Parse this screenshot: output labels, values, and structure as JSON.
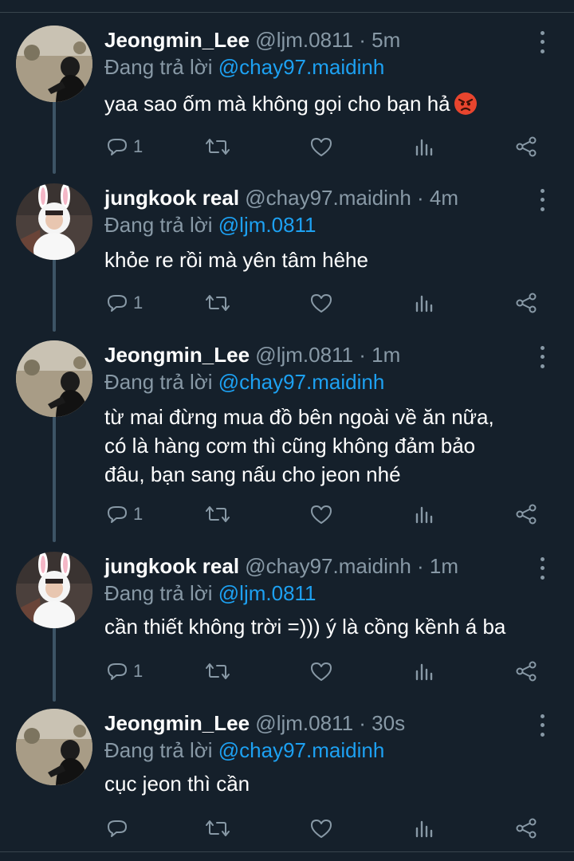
{
  "tweets": [
    {
      "name": "Jeongmin_Lee",
      "handle": "@ljm.0811",
      "time": "· 5m",
      "replying_prefix": "Đang trả lời ",
      "replying_to": "@chay97.maidinh",
      "text": "yaa sao ốm mà không gọi cho bạn hả",
      "emoji": "angry-face-emoji",
      "reply_count": "1",
      "avatar": "jeongmin-avatar"
    },
    {
      "name": "jungkook real",
      "handle": "@chay97.maidinh",
      "time": "· 4m",
      "replying_prefix": "Đang trả lời ",
      "replying_to": "@ljm.0811",
      "text": "khỏe re rồi mà yên tâm hêhe",
      "reply_count": "1",
      "avatar": "jungkook-bunny-avatar"
    },
    {
      "name": "Jeongmin_Lee",
      "handle": "@ljm.0811",
      "time": "· 1m",
      "replying_prefix": "Đang trả lời ",
      "replying_to": "@chay97.maidinh",
      "text_lines": [
        "từ mai đừng mua đồ bên ngoài về ăn nữa,",
        "có là hàng cơm thì cũng không đảm bảo",
        "đâu, bạn sang nấu cho jeon nhé"
      ],
      "reply_count": "1",
      "avatar": "jeongmin-avatar"
    },
    {
      "name": "jungkook real",
      "handle": "@chay97.maidinh",
      "time": "· 1m",
      "replying_prefix": "Đang trả lời ",
      "replying_to": "@ljm.0811",
      "text": "cần thiết không trời =))) ý là cồng kềnh á ba",
      "reply_count": "1",
      "avatar": "jungkook-bunny-avatar"
    },
    {
      "name": "Jeongmin_Lee",
      "handle": "@ljm.0811",
      "time": "· 30s",
      "replying_prefix": "Đang trả lời ",
      "replying_to": "@chay97.maidinh",
      "text": "cục jeon thì cần",
      "reply_count": "",
      "avatar": "jeongmin-avatar"
    }
  ],
  "colors": {
    "background": "#15202b",
    "secondary_text": "#8899a6",
    "mention": "#1da1f2",
    "divider": "#38444d"
  }
}
